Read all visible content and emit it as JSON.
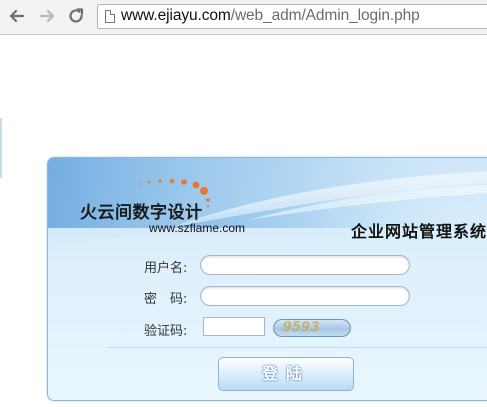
{
  "browser": {
    "url_host": "www.ejiayu.com",
    "url_path": "/web_adm/Admin_login.php",
    "back_icon": "arrow-left",
    "forward_icon": "arrow-right",
    "reload_icon": "reload"
  },
  "panel": {
    "brand_name": "火云间数字设计",
    "brand_url": "www.szflame.com",
    "system_title": "企业网站管理系统",
    "accent_color": "#e8762b",
    "fields": {
      "username_label": "用户名:",
      "password_label": "密　码:",
      "captcha_label": "验证码:",
      "username_value": "",
      "password_value": "",
      "captcha_value": ""
    },
    "captcha_code": "9593",
    "login_label": "登陆"
  }
}
